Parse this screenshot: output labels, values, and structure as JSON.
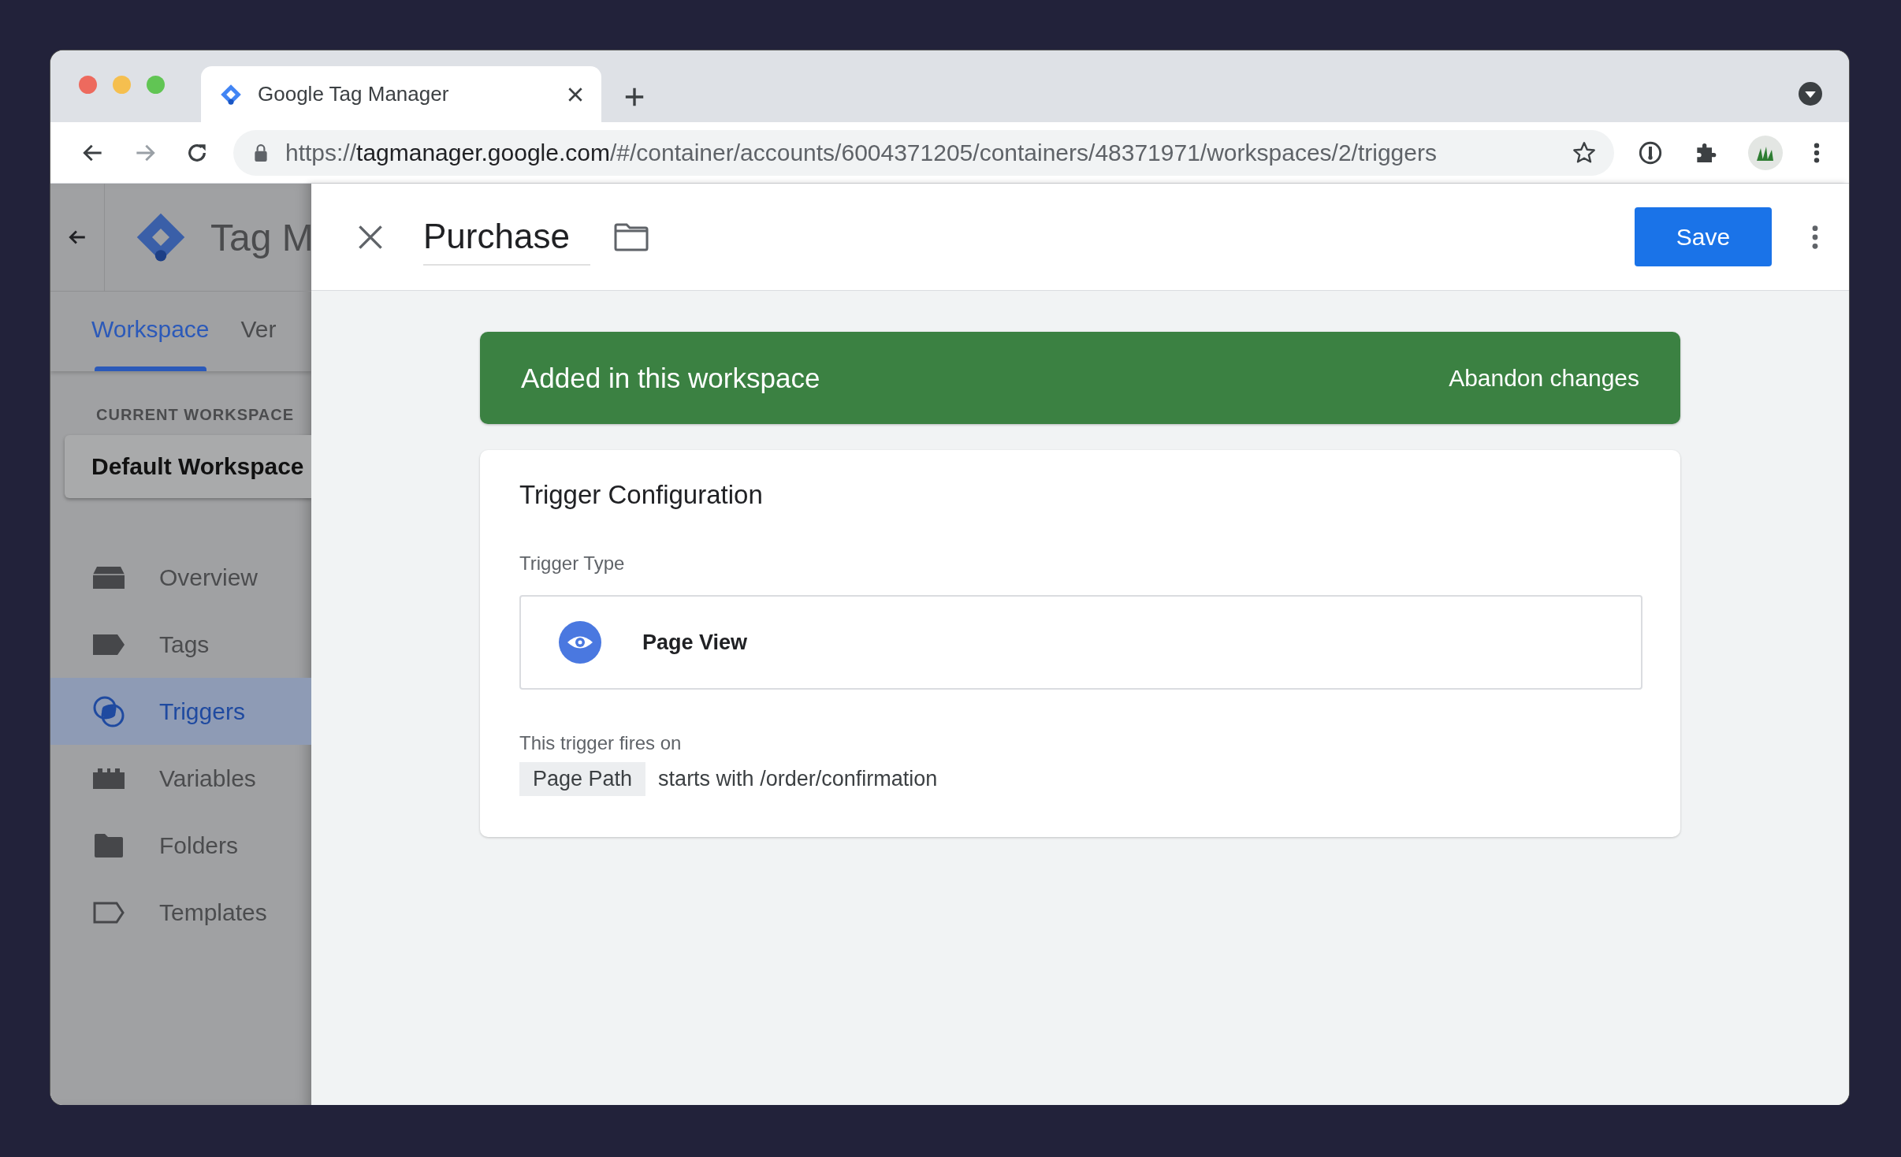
{
  "browser": {
    "tab_title": "Google Tag Manager",
    "url": {
      "scheme": "https://",
      "host": "tagmanager.google.com",
      "path": "/#/container/accounts/6004371205/containers/48371971/workspaces/2/triggers"
    }
  },
  "sidebar": {
    "title": "Tag M",
    "tabs": [
      {
        "label": "Workspace",
        "selected": true
      },
      {
        "label": "Ver",
        "selected": false
      }
    ],
    "workspace_label": "CURRENT WORKSPACE",
    "workspace_name": "Default Workspace",
    "nav": [
      {
        "label": "Overview",
        "selected": false
      },
      {
        "label": "Tags",
        "selected": false
      },
      {
        "label": "Triggers",
        "selected": true
      },
      {
        "label": "Variables",
        "selected": false
      },
      {
        "label": "Folders",
        "selected": false
      },
      {
        "label": "Templates",
        "selected": false
      }
    ]
  },
  "panel": {
    "title": "Purchase",
    "save": "Save",
    "banner": {
      "text": "Added in this workspace",
      "action": "Abandon changes"
    },
    "card": {
      "title": "Trigger Configuration",
      "type_label": "Trigger Type",
      "type": "Page View",
      "fires_label": "This trigger fires on",
      "condition": {
        "variable": "Page Path",
        "rule": "starts with /order/confirmation"
      }
    }
  }
}
